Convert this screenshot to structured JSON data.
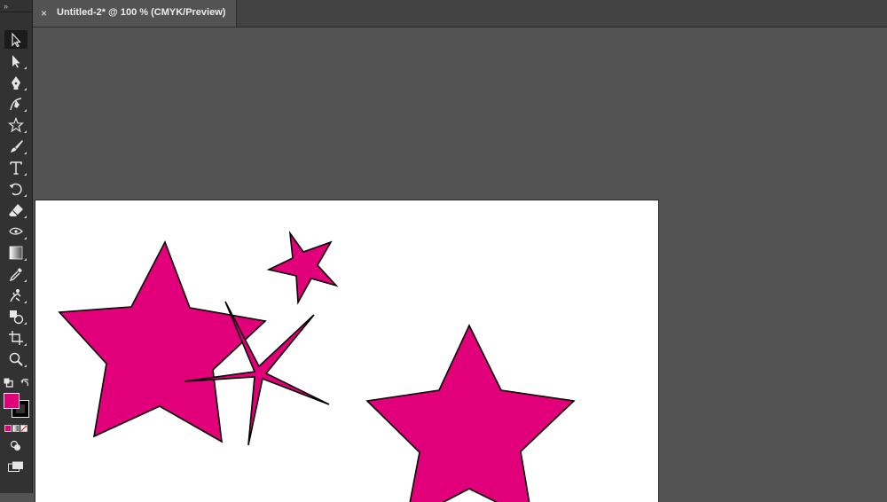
{
  "document": {
    "tab_title": "Untitled-2* @ 100 % (CMYK/Preview)",
    "close_glyph": "×"
  },
  "toolbar": {
    "grip_glyph": "››",
    "tools": [
      "selection-tool-icon",
      "direct-selection-tool-icon",
      "pen-tool-icon",
      "curvature-tool-icon",
      "star-tool-icon",
      "paintbrush-tool-icon",
      "type-tool-icon",
      "rotate-tool-icon",
      "eraser-tool-icon",
      "width-tool-icon",
      "gradient-tool-icon",
      "eyedropper-tool-icon",
      "puppet-warp-tool-icon",
      "shape-builder-tool-icon",
      "artboard-tool-icon",
      "zoom-tool-icon"
    ],
    "fill_color": "#e2007a",
    "stroke_color": "#000000"
  },
  "colors": {
    "star_fill": "#e2007a",
    "star_stroke": "#000000",
    "pasteboard": "#535353",
    "artboard": "#ffffff"
  }
}
